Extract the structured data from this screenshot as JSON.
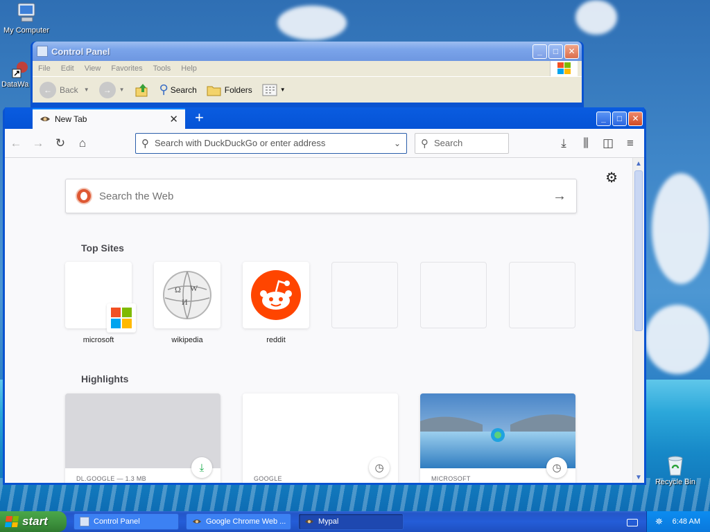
{
  "desktop": {
    "icons": [
      {
        "label": "My Computer"
      },
      {
        "label": "DataWa"
      },
      {
        "label": "Recycle Bin"
      }
    ]
  },
  "control_panel": {
    "title": "Control Panel",
    "menu": [
      "File",
      "Edit",
      "View",
      "Favorites",
      "Tools",
      "Help"
    ],
    "toolbar": {
      "back": "Back",
      "search": "Search",
      "folders": "Folders"
    }
  },
  "browser": {
    "tab_title": "New Tab",
    "address_placeholder": "Search with DuckDuckGo or enter address",
    "search_placeholder": "Search",
    "web_search_placeholder": "Search the Web",
    "top_sites_title": "Top Sites",
    "top_sites": [
      {
        "label": "microsoft"
      },
      {
        "label": "wikipedia"
      },
      {
        "label": "reddit"
      }
    ],
    "highlights_title": "Highlights",
    "highlights": [
      {
        "source": "DL.GOOGLE — 1.3 MB"
      },
      {
        "source": "GOOGLE"
      },
      {
        "source": "MICROSOFT"
      }
    ]
  },
  "taskbar": {
    "start": "start",
    "tasks": [
      "Control Panel",
      "Google Chrome Web ...",
      "Mypal"
    ],
    "clock": "6:48 AM"
  },
  "colors": {
    "accent": "#0a84ff",
    "xp_blue": "#0553d6",
    "reddit": "#ff4500",
    "duckduckgo": "#de5833"
  }
}
